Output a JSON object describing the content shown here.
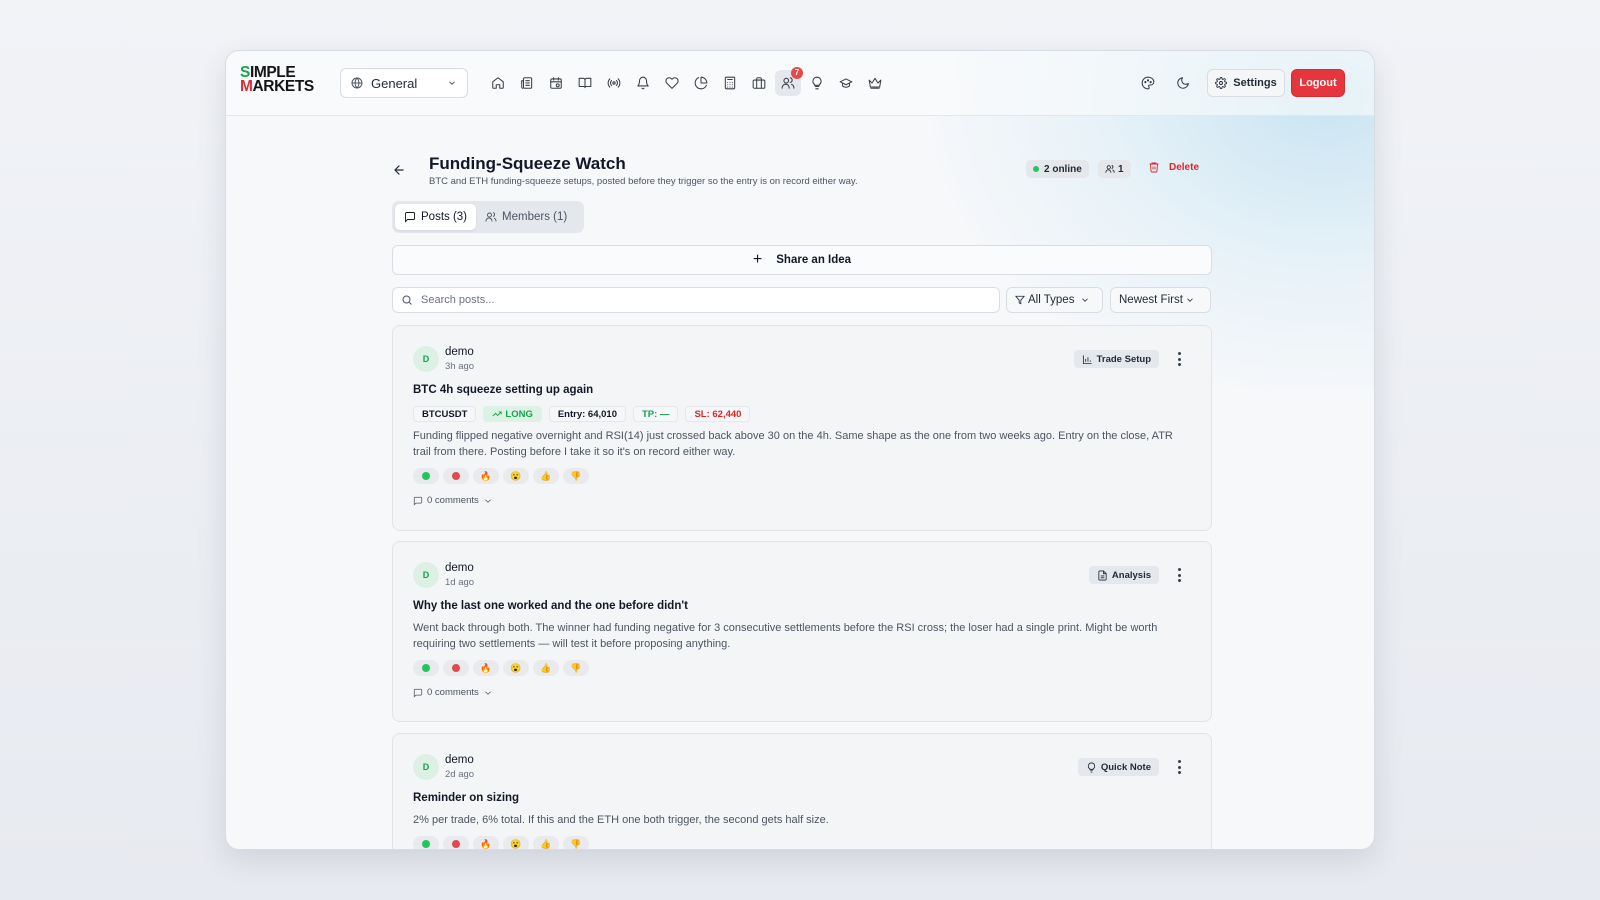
{
  "app": {
    "logo_line1_s": "S",
    "logo_line1_rest": "IMPLE",
    "logo_line2_m": "M",
    "logo_line2_rest": "ARKETS",
    "workspace": "General",
    "nav_badge_count": "7",
    "settings_label": "Settings",
    "logout_label": "Logout",
    "nav_icons": [
      "home-icon",
      "newspaper-icon",
      "calendar-icon",
      "book-icon",
      "radio-icon",
      "bell-icon",
      "heart-icon",
      "pie-chart-icon",
      "calculator-icon",
      "briefcase-icon",
      "users-icon",
      "lightbulb-icon",
      "graduation-cap-icon",
      "crown-icon"
    ],
    "accent_red": "#e5353d"
  },
  "group": {
    "title": "Funding-Squeeze Watch",
    "description": "BTC and ETH funding-squeeze setups, posted before they trigger so the entry is on record either way.",
    "online": "2 online",
    "members_count": "1",
    "delete_label": "Delete"
  },
  "tabs": {
    "posts": "Posts (3)",
    "members": "Members (1)"
  },
  "share_label": "Share an Idea",
  "filters": {
    "search_placeholder": "Search posts...",
    "type_filter": "All Types",
    "sort": "Newest First"
  },
  "posts": [
    {
      "avatar": "D",
      "author": "demo",
      "time": "3h ago",
      "type": "Trade Setup",
      "title": "BTC 4h squeeze setting up again",
      "symbol": "BTCUSDT",
      "direction": "LONG",
      "entry": "Entry: 64,010",
      "tp": "TP: —",
      "sl": "SL: 62,440",
      "body": "Funding flipped negative overnight and RSI(14) just crossed back above 30 on the 4h. Same shape as the one from two weeks ago. Entry on the close, ATR trail from there. Posting before I take it so it's on record either way.",
      "comments": "0 comments"
    },
    {
      "avatar": "D",
      "author": "demo",
      "time": "1d ago",
      "type": "Analysis",
      "title": "Why the last one worked and the one before didn't",
      "body": "Went back through both. The winner had funding negative for 3 consecutive settlements before the RSI cross; the loser had a single print. Might be worth requiring two settlements — will test it before proposing anything.",
      "comments": "0 comments"
    },
    {
      "avatar": "D",
      "author": "demo",
      "time": "2d ago",
      "type": "Quick Note",
      "title": "Reminder on sizing",
      "body": "2% per trade, 6% total. If this and the ETH one both trigger, the second gets half size."
    }
  ],
  "reactions": [
    "green-circle",
    "red-circle",
    "🔥",
    "😮",
    "👍",
    "👎"
  ]
}
